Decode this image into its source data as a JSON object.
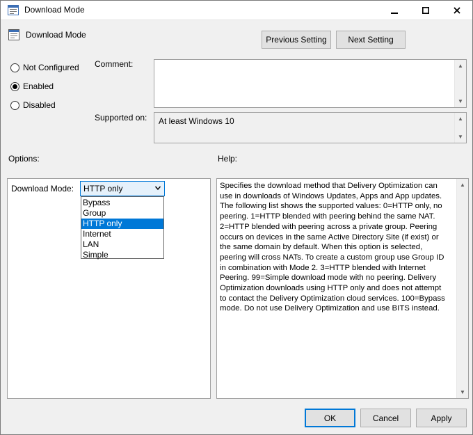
{
  "window": {
    "title": "Download Mode",
    "minimize_glyph": "—",
    "close_glyph": "✕"
  },
  "header": {
    "title": "Download Mode"
  },
  "nav": {
    "previous_label": "Previous Setting",
    "next_label": "Next Setting"
  },
  "state_options": [
    {
      "label": "Not Configured",
      "checked": false
    },
    {
      "label": "Enabled",
      "checked": true
    },
    {
      "label": "Disabled",
      "checked": false
    }
  ],
  "comment": {
    "label": "Comment:",
    "value": ""
  },
  "supported": {
    "label": "Supported on:",
    "value": "At least Windows 10"
  },
  "options": {
    "label": "Options:",
    "download_mode_label": "Download Mode:",
    "selected": "HTTP only",
    "items": [
      "Bypass",
      "Group",
      "HTTP only",
      "Internet",
      "LAN",
      "Simple"
    ],
    "selected_index": 2
  },
  "help": {
    "label": "Help:",
    "text": "Specifies the download method that Delivery Optimization can use in downloads of Windows Updates, Apps and App updates. The following list shows the supported values: 0=HTTP only, no peering. 1=HTTP blended with peering behind the same NAT. 2=HTTP blended with peering across a private group. Peering occurs on devices in the same Active Directory Site (if exist) or the same domain by default. When this option is selected, peering will cross NATs. To create a custom group use Group ID in combination with Mode 2. 3=HTTP blended with Internet Peering. 99=Simple download mode with no peering. Delivery Optimization downloads using HTTP only and does not attempt to contact the Delivery Optimization cloud services. 100=Bypass mode. Do not use Delivery Optimization and use BITS instead."
  },
  "footer": {
    "ok_label": "OK",
    "cancel_label": "Cancel",
    "apply_label": "Apply"
  },
  "colors": {
    "accent": "#0078d7",
    "close_hover": "#e81123",
    "face": "#f0f0f0"
  },
  "icons": [
    "policy-icon",
    "minimize-icon",
    "maximize-icon",
    "close-icon",
    "chevron-down-icon",
    "scroll-up-icon",
    "scroll-down-icon"
  ]
}
